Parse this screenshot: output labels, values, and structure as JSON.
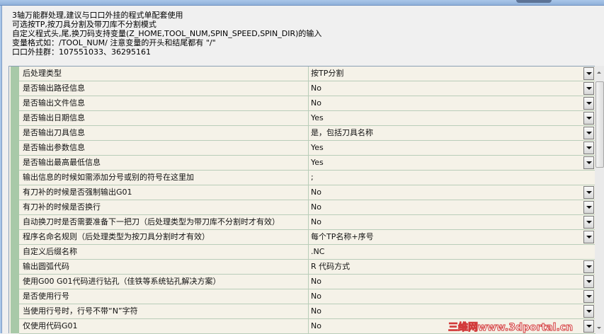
{
  "description": [
    "3轴万能群处理,建议与口口外挂的程式单配套使用",
    "可选按TP,按刀具分割及带刀库不分割模式",
    "自定义程式头,尾,换刀码支持变量(Z_HOME,TOOL_NUM,SPIN_SPEED,SPIN_DIR)的输入",
    "变量格式如：/TOOL_NUM/ 注意变量的开头和结尾都有 \"/\"",
    "口口外挂群：107551033、36295161"
  ],
  "properties": [
    {
      "label": "后处理类型",
      "value": "按TP分割",
      "dropdown": true
    },
    {
      "label": "是否输出路径信息",
      "value": "No",
      "dropdown": true
    },
    {
      "label": "是否输出文件信息",
      "value": "No",
      "dropdown": true
    },
    {
      "label": "是否输出日期信息",
      "value": "Yes",
      "dropdown": true
    },
    {
      "label": "是否输出刀具信息",
      "value": "是，包括刀具名称",
      "dropdown": true
    },
    {
      "label": "是否输出参数信息",
      "value": "Yes",
      "dropdown": true
    },
    {
      "label": "是否输出最高最低信息",
      "value": "Yes",
      "dropdown": true
    },
    {
      "label": "输出信息的时候如需添加分号或别的符号在这里加",
      "value": ";",
      "dropdown": false
    },
    {
      "label": "有刀补的时候是否强制输出G01",
      "value": "No",
      "dropdown": true
    },
    {
      "label": "有刀补的时候是否换行",
      "value": "No",
      "dropdown": true
    },
    {
      "label": "自动换刀时是否需要准备下一把刀（后处理类型为带刀库不分割时才有效）",
      "value": "No",
      "dropdown": true
    },
    {
      "label": "程序名命名规则（后处理类型为按刀具分割时才有效）",
      "value": "每个TP名称+序号",
      "dropdown": true
    },
    {
      "label": "自定义后缀名称",
      "value": ".NC",
      "dropdown": false
    },
    {
      "label": "输出圆弧代码",
      "value": "R 代码方式",
      "dropdown": true
    },
    {
      "label": "使用G00 G01代码进行钻孔（佳铁等系统钻孔解决方案）",
      "value": "No",
      "dropdown": true
    },
    {
      "label": "是否使用行号",
      "value": "No",
      "dropdown": true
    },
    {
      "label": "当使用行号时，行号不带“N”字符",
      "value": "No",
      "dropdown": true
    },
    {
      "label": "仅使用代码G01",
      "value": "No",
      "dropdown": true
    }
  ],
  "watermark": "三维网www.3dportal.cn"
}
